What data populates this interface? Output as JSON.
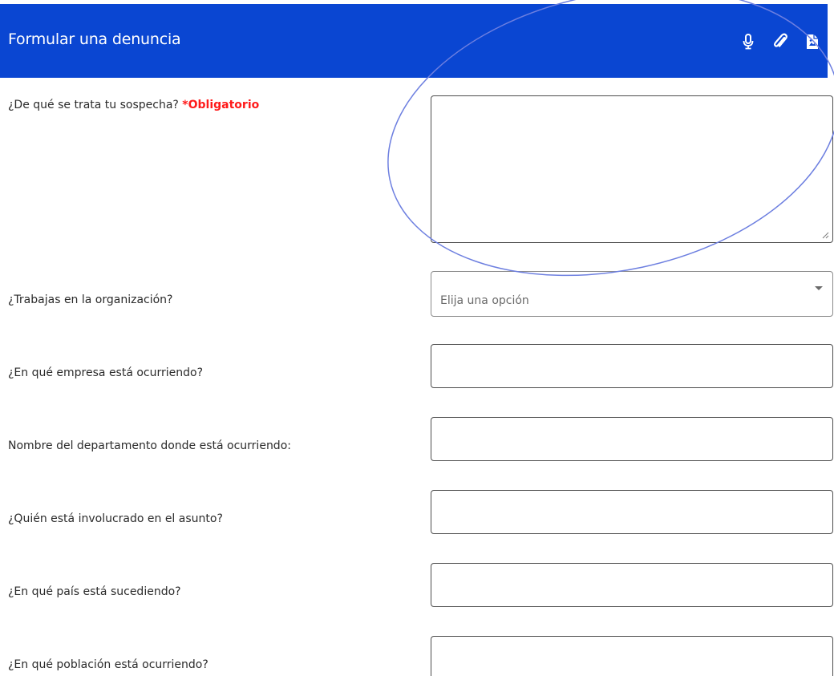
{
  "header": {
    "title": "Formular una denuncia",
    "background_color": "#0a46d2",
    "icons": [
      "microphone-icon",
      "paperclip-icon",
      "file-image-icon"
    ]
  },
  "form": {
    "suspicion": {
      "label": "¿De qué se trata tu sospecha?",
      "required_text": "*Obligatorio",
      "value": ""
    },
    "works_in_org": {
      "label": "¿Trabajas en la organización?",
      "selected": "Elija una opción"
    },
    "company": {
      "label": "¿En qué empresa está ocurriendo?",
      "value": ""
    },
    "department": {
      "label": "Nombre del departamento donde está ocurriendo:",
      "value": ""
    },
    "involved": {
      "label": "¿Quién está involucrado en el asunto?",
      "value": ""
    },
    "country": {
      "label": "¿En qué país está sucediendo?",
      "value": ""
    },
    "town": {
      "label": "¿En qué población está ocurriendo?",
      "value": ""
    }
  },
  "colors": {
    "required": "#ff1a1a",
    "annotation": "#6d7fe0"
  }
}
